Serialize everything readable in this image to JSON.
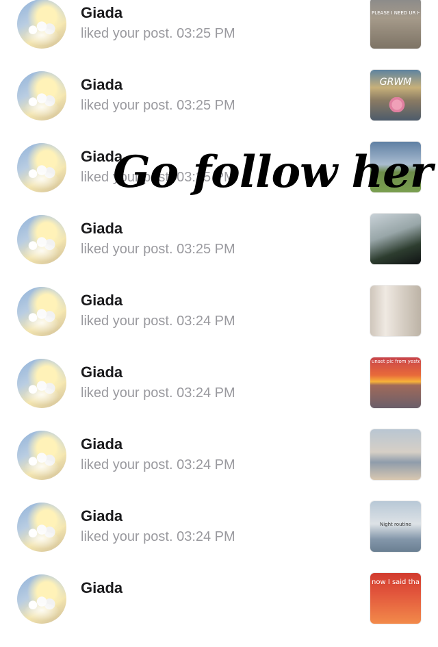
{
  "notifications": [
    {
      "user": "Giada",
      "text": "liked your post. 03:25 PM",
      "thumb_caption": "PLEASE I NEED UR HELP!!!",
      "thumb_style": "t-beach"
    },
    {
      "user": "Giada",
      "text": "liked your post. 03:25 PM",
      "thumb_caption": "GRWM",
      "thumb_style": "t-grwm"
    },
    {
      "user": "Giada",
      "text": "liked your post. 03:25 PM",
      "thumb_caption": "",
      "thumb_style": "t-field"
    },
    {
      "user": "Giada",
      "text": "liked your post. 03:25 PM",
      "thumb_caption": "",
      "thumb_style": "t-car"
    },
    {
      "user": "Giada",
      "text": "liked your post. 03:24 PM",
      "thumb_caption": "",
      "thumb_style": "t-hall"
    },
    {
      "user": "Giada",
      "text": "liked your post. 03:24 PM",
      "thumb_caption": "unset pic from yesterday",
      "thumb_style": "t-sunset"
    },
    {
      "user": "Giada",
      "text": "liked your post. 03:24 PM",
      "thumb_caption": "",
      "thumb_style": "t-sea"
    },
    {
      "user": "Giada",
      "text": "liked your post. 03:24 PM",
      "thumb_caption": "Night routine",
      "thumb_style": "t-night"
    },
    {
      "user": "Giada",
      "text": "",
      "thumb_caption": "now I said that I",
      "thumb_style": "t-sea2"
    }
  ],
  "overlay_text": "Go follow her"
}
